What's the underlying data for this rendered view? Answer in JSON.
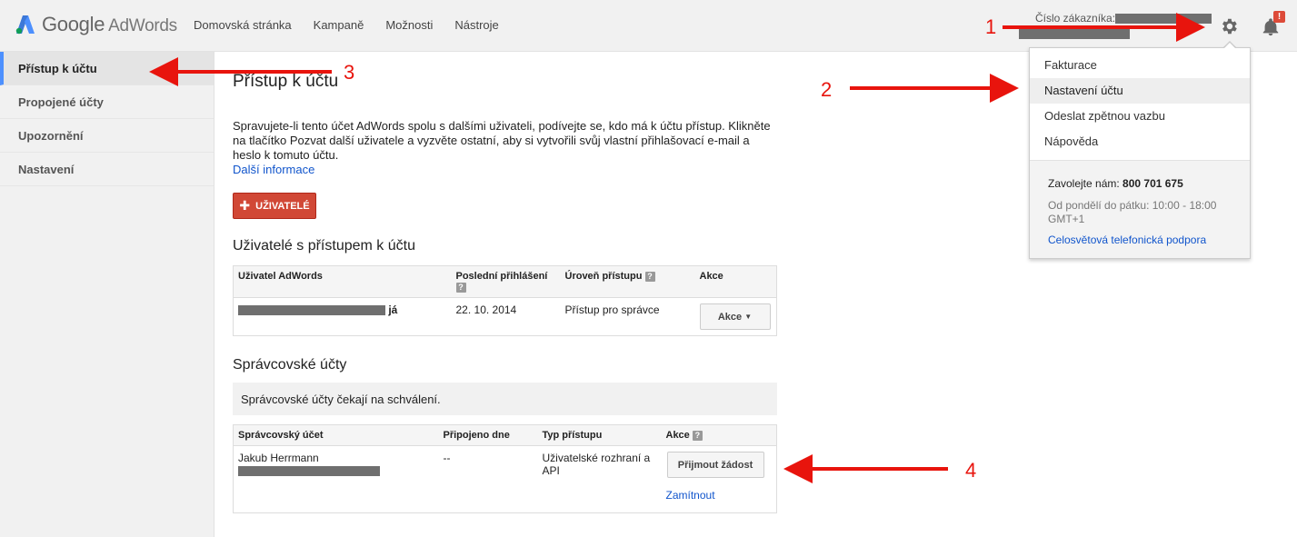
{
  "header": {
    "logo_google": "Google",
    "logo_adwords": "AdWords",
    "nav": [
      "Domovská stránka",
      "Kampaně",
      "Možnosti",
      "Nástroje"
    ],
    "customer_label": "Číslo zákazníka:",
    "notification_badge": "!"
  },
  "sidebar": {
    "items": [
      {
        "label": "Přístup k účtu",
        "active": true
      },
      {
        "label": "Propojené účty"
      },
      {
        "label": "Upozornění"
      },
      {
        "label": "Nastavení"
      }
    ]
  },
  "main": {
    "title": "Přístup k účtu",
    "description": "Spravujete-li tento účet AdWords spolu s dalšími uživateli, podívejte se, kdo má k účtu přístup. Klikněte na tlačítko Pozvat další uživatele a vyzvěte ostatní, aby si vytvořili svůj vlastní přihlašovací e-mail a heslo k tomuto účtu.",
    "more_info": "Další informace",
    "users_button": "UŽIVATELÉ",
    "users_section_title": "Uživatelé s přístupem k účtu",
    "users_table": {
      "headers": [
        "Uživatel AdWords",
        "Poslední přihlášení",
        "Úroveň přístupu",
        "Akce"
      ],
      "rows": [
        {
          "user_suffix": "já",
          "last_login": "22. 10. 2014",
          "access": "Přístup pro správce",
          "action": "Akce"
        }
      ]
    },
    "manager_section_title": "Správcovské účty",
    "manager_notice": "Správcovské účty čekají na schválení.",
    "manager_table": {
      "headers": [
        "Správcovský účet",
        "Připojeno dne",
        "Typ přístupu",
        "Akce"
      ],
      "rows": [
        {
          "name": "Jakub Herrmann",
          "connected": "--",
          "type": "Uživatelské rozhraní a API",
          "accept": "Přijmout žádost",
          "reject": "Zamítnout"
        }
      ]
    },
    "help_glyph": "?"
  },
  "menu": {
    "items": [
      "Fakturace",
      "Nastavení účtu",
      "Odeslat zpětnou vazbu",
      "Nápověda"
    ],
    "highlighted_index": 1,
    "call_label": "Zavolejte nám:",
    "call_number": "800 701 675",
    "hours": "Od pondělí do pátku: 10:00 - 18:00 GMT+1",
    "support_link": "Celosvětová telefonická podpora"
  },
  "annotations": [
    "1",
    "2",
    "3",
    "4"
  ],
  "colors": {
    "accent_red": "#d14836",
    "annotation_red": "#e8140d",
    "link": "#1155cc"
  }
}
